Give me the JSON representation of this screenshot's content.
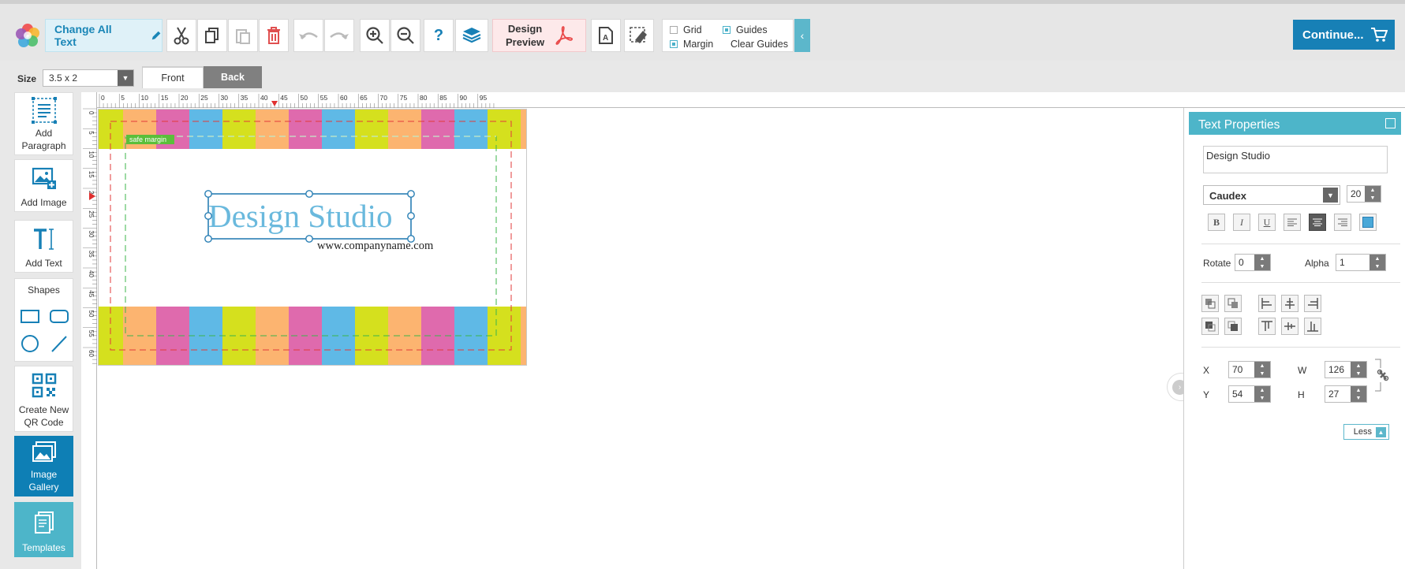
{
  "toolbar": {
    "change_all_text": "Change All Text",
    "design_preview_line1": "Design",
    "design_preview_line2": "Preview",
    "grid_label": "Grid",
    "guides_label": "Guides",
    "margin_label": "Margin",
    "clear_guides_label": "Clear Guides",
    "grid_checked": false,
    "guides_checked": true,
    "margin_checked": true,
    "continue_label": "Continue..."
  },
  "size": {
    "label": "Size",
    "value": "3.5 x 2"
  },
  "tabs": [
    {
      "label": "Front",
      "active": true
    },
    {
      "label": "Back",
      "active": false
    }
  ],
  "sidebar": {
    "add_paragraph": "Add Paragraph",
    "add_image": "Add Image",
    "add_text": "Add Text",
    "shapes_title": "Shapes",
    "create_qr": "Create New QR Code",
    "image_gallery": "Image Gallery",
    "templates": "Templates"
  },
  "ruler": {
    "unit": "mm",
    "top_ticks": [
      "0",
      "5",
      "10",
      "15",
      "20",
      "25",
      "30",
      "35",
      "40",
      "45",
      "50",
      "55",
      "60",
      "65",
      "70",
      "75",
      "80",
      "85",
      "90",
      "95"
    ],
    "left_ticks": [
      "0",
      "5",
      "10",
      "15",
      "20",
      "25",
      "30",
      "35",
      "40",
      "45",
      "50",
      "55",
      "60"
    ]
  },
  "card": {
    "safe_margin_label": "safe margin",
    "title": "Design Studio",
    "website": "www.companyname.com",
    "stripe_colors": [
      "#d5e01e",
      "#fcb470",
      "#df6aad",
      "#5fb9e6"
    ],
    "title_color": "#6ab9dd"
  },
  "properties": {
    "title": "Text Properties",
    "text_value": "Design Studio",
    "font": "Caudex",
    "font_size": "20",
    "bold": "B",
    "italic": "I",
    "underline": "U",
    "rotate_label": "Rotate",
    "rotate_value": "0",
    "alpha_label": "Alpha",
    "alpha_value": "1",
    "x_label": "X",
    "x_value": "70",
    "y_label": "Y",
    "y_value": "54",
    "w_label": "W",
    "w_value": "126",
    "h_label": "H",
    "h_value": "27",
    "less_label": "Less",
    "text_color": "#4aa8d8"
  }
}
